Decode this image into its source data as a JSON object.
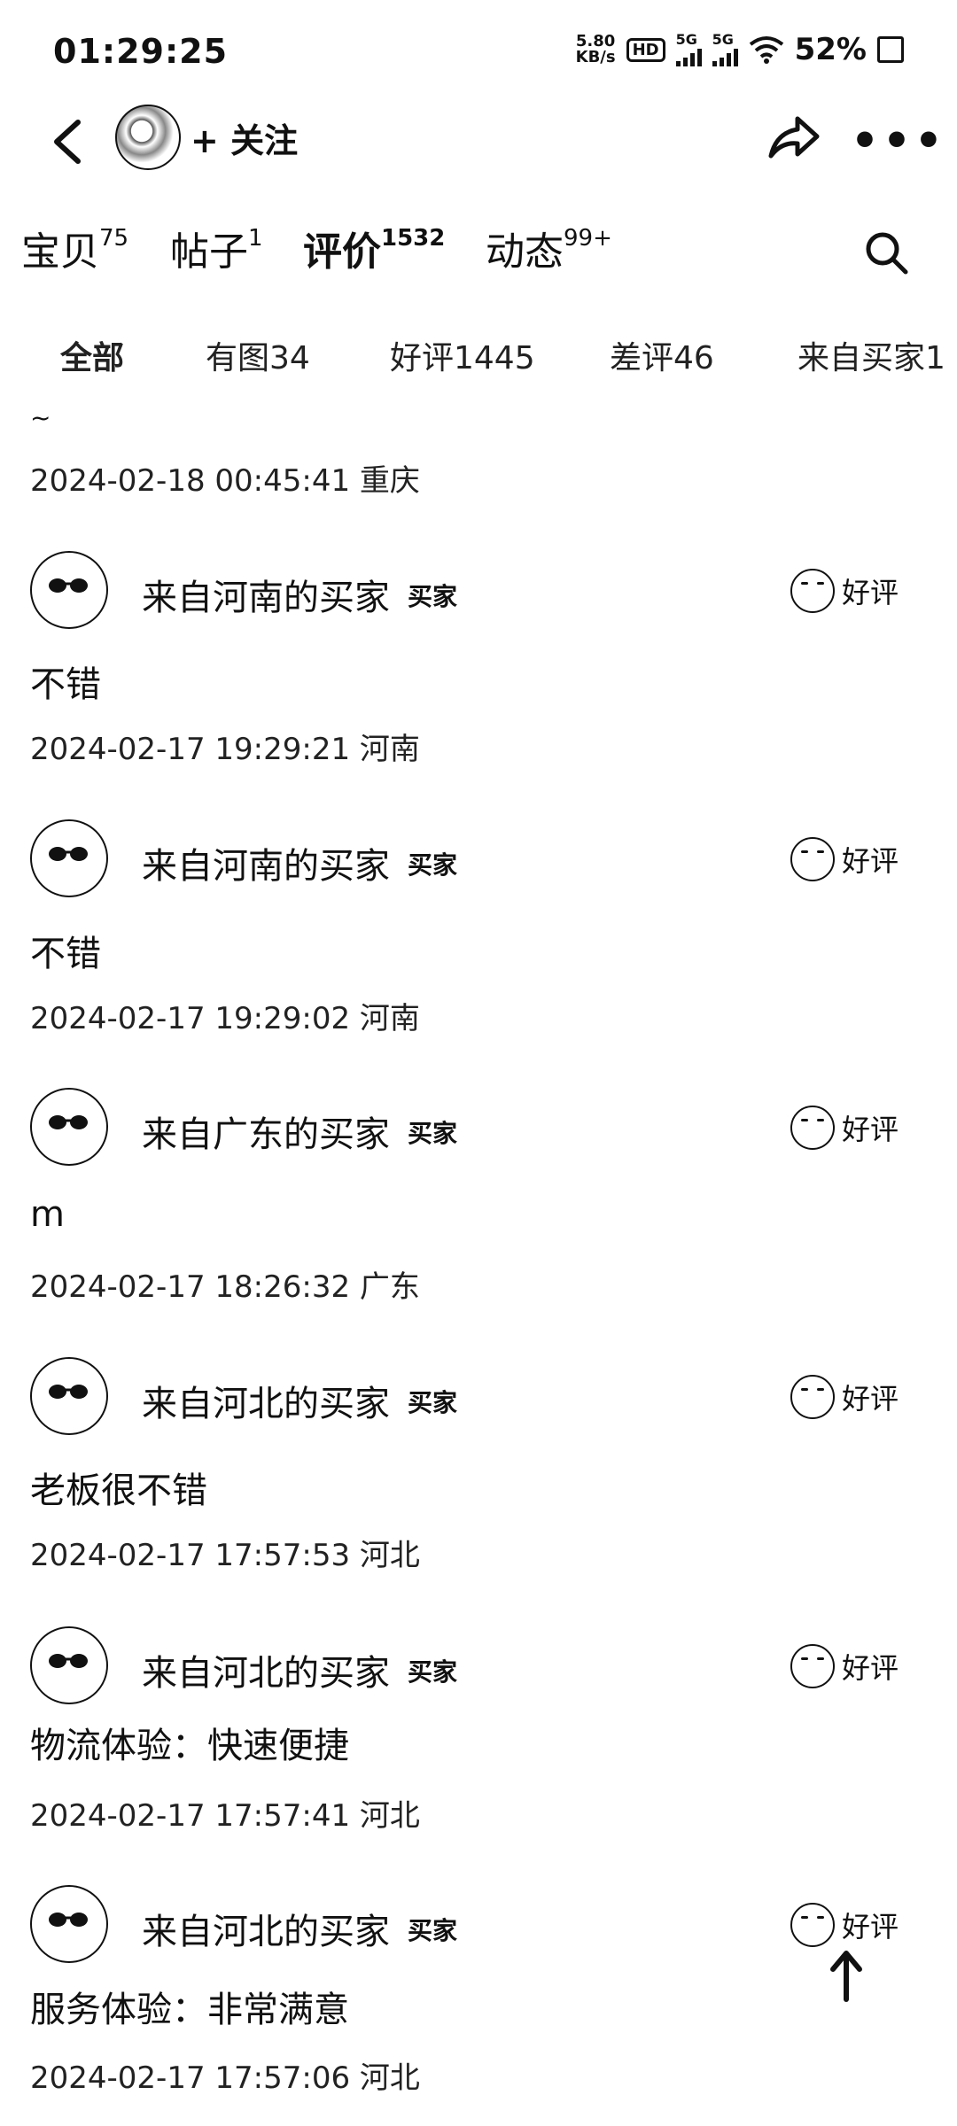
{
  "status_bar": {
    "time": "01:29:25",
    "speed_value": "5.80",
    "speed_unit": "KB/s",
    "hd_label": "HD",
    "sim1": "5G",
    "sim2": "5G",
    "battery": "52%"
  },
  "header": {
    "follow_label": "+ 关注"
  },
  "tabs": [
    {
      "label": "宝贝",
      "count": "75"
    },
    {
      "label": "帖子",
      "count": "1"
    },
    {
      "label": "评价",
      "count": "1532"
    },
    {
      "label": "动态",
      "count": "99+"
    }
  ],
  "filters": [
    "全部",
    "有图34",
    "好评1445",
    "差评46",
    "来自买家1"
  ],
  "partial_top": {
    "fragment": "~",
    "date": "2024-02-18 00:45:41 重庆"
  },
  "reviews": [
    {
      "user": "来自河南的买家",
      "tag": "买家",
      "rating": "好评",
      "content": "不错",
      "date": "2024-02-17 19:29:21 河南"
    },
    {
      "user": "来自河南的买家",
      "tag": "买家",
      "rating": "好评",
      "content": "不错",
      "date": "2024-02-17 19:29:02 河南"
    },
    {
      "user": "来自广东的买家",
      "tag": "买家",
      "rating": "好评",
      "content": "m",
      "date": "2024-02-17 18:26:32 广东"
    },
    {
      "user": "来自河北的买家",
      "tag": "买家",
      "rating": "好评",
      "content": "老板很不错",
      "date": "2024-02-17 17:57:53 河北"
    },
    {
      "user": "来自河北的买家",
      "tag": "买家",
      "rating": "好评",
      "content": "物流体验：快速便捷",
      "date": "2024-02-17 17:57:41 河北"
    },
    {
      "user": "来自河北的买家",
      "tag": "买家",
      "rating": "好评",
      "content": "服务体验：非常满意",
      "date": "2024-02-17 17:57:06 河北"
    }
  ]
}
